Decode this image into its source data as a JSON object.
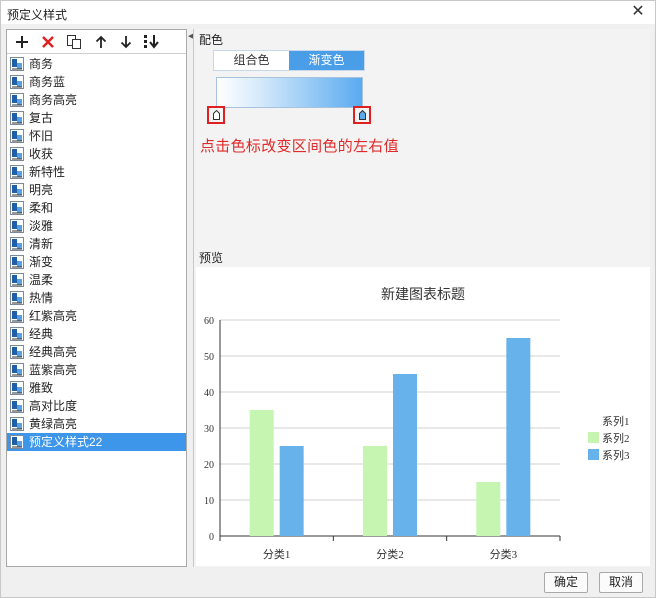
{
  "window": {
    "title": "预定义样式",
    "close_glyph": "✕"
  },
  "toolbar": {
    "buttons": [
      {
        "name": "add",
        "icon": "plus-icon"
      },
      {
        "name": "delete",
        "icon": "red-x-icon"
      },
      {
        "name": "copy",
        "icon": "copy-icon"
      },
      {
        "name": "move-up",
        "icon": "arrow-up-icon"
      },
      {
        "name": "move-down",
        "icon": "arrow-down-icon"
      },
      {
        "name": "move-bottom",
        "icon": "arrow-to-bottom-icon"
      }
    ]
  },
  "styles_list": {
    "items": [
      "商务",
      "商务蓝",
      "商务高亮",
      "复古",
      "怀旧",
      "收获",
      "新特性",
      "明亮",
      "柔和",
      "淡雅",
      "清新",
      "渐变",
      "温柔",
      "热情",
      "红紫高亮",
      "经典",
      "经典高亮",
      "蓝紫高亮",
      "雅致",
      "高对比度",
      "黄绿高亮",
      "预定义样式22"
    ],
    "selected_index": 21
  },
  "color_section": {
    "label": "配色",
    "tabs": [
      {
        "label": "组合色",
        "active": false
      },
      {
        "label": "渐变色",
        "active": true
      }
    ],
    "gradient": {
      "start_color": "#ffffff",
      "end_color": "#5aaaf0"
    },
    "hint": "点击色标改变区间色的左右值"
  },
  "preview": {
    "label": "预览",
    "chart_data": {
      "type": "bar",
      "title": "新建图表标题",
      "categories": [
        "分类1",
        "分类2",
        "分类3"
      ],
      "series": [
        {
          "name": "系列1",
          "values": [
            0,
            0,
            0
          ],
          "color": "#ffffff"
        },
        {
          "name": "系列2",
          "values": [
            35,
            25,
            15
          ],
          "color": "#c5f5b0"
        },
        {
          "name": "系列3",
          "values": [
            25,
            45,
            55
          ],
          "color": "#68b2ec"
        }
      ],
      "ylim": [
        0,
        60
      ],
      "yticks": [
        "0",
        "10",
        "20",
        "30",
        "40",
        "50",
        "60"
      ],
      "grid": true,
      "legend_position": "right"
    }
  },
  "buttons": {
    "ok": "确定",
    "cancel": "取消"
  }
}
